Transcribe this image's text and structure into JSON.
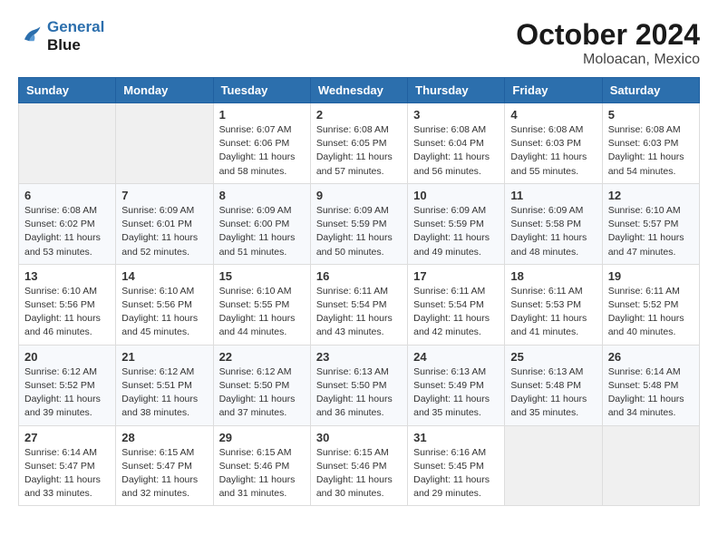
{
  "header": {
    "logo_line1": "General",
    "logo_line2": "Blue",
    "month": "October 2024",
    "location": "Moloacan, Mexico"
  },
  "weekdays": [
    "Sunday",
    "Monday",
    "Tuesday",
    "Wednesday",
    "Thursday",
    "Friday",
    "Saturday"
  ],
  "weeks": [
    [
      {
        "day": "",
        "sunrise": "",
        "sunset": "",
        "daylight": ""
      },
      {
        "day": "",
        "sunrise": "",
        "sunset": "",
        "daylight": ""
      },
      {
        "day": "1",
        "sunrise": "Sunrise: 6:07 AM",
        "sunset": "Sunset: 6:06 PM",
        "daylight": "Daylight: 11 hours and 58 minutes."
      },
      {
        "day": "2",
        "sunrise": "Sunrise: 6:08 AM",
        "sunset": "Sunset: 6:05 PM",
        "daylight": "Daylight: 11 hours and 57 minutes."
      },
      {
        "day": "3",
        "sunrise": "Sunrise: 6:08 AM",
        "sunset": "Sunset: 6:04 PM",
        "daylight": "Daylight: 11 hours and 56 minutes."
      },
      {
        "day": "4",
        "sunrise": "Sunrise: 6:08 AM",
        "sunset": "Sunset: 6:03 PM",
        "daylight": "Daylight: 11 hours and 55 minutes."
      },
      {
        "day": "5",
        "sunrise": "Sunrise: 6:08 AM",
        "sunset": "Sunset: 6:03 PM",
        "daylight": "Daylight: 11 hours and 54 minutes."
      }
    ],
    [
      {
        "day": "6",
        "sunrise": "Sunrise: 6:08 AM",
        "sunset": "Sunset: 6:02 PM",
        "daylight": "Daylight: 11 hours and 53 minutes."
      },
      {
        "day": "7",
        "sunrise": "Sunrise: 6:09 AM",
        "sunset": "Sunset: 6:01 PM",
        "daylight": "Daylight: 11 hours and 52 minutes."
      },
      {
        "day": "8",
        "sunrise": "Sunrise: 6:09 AM",
        "sunset": "Sunset: 6:00 PM",
        "daylight": "Daylight: 11 hours and 51 minutes."
      },
      {
        "day": "9",
        "sunrise": "Sunrise: 6:09 AM",
        "sunset": "Sunset: 5:59 PM",
        "daylight": "Daylight: 11 hours and 50 minutes."
      },
      {
        "day": "10",
        "sunrise": "Sunrise: 6:09 AM",
        "sunset": "Sunset: 5:59 PM",
        "daylight": "Daylight: 11 hours and 49 minutes."
      },
      {
        "day": "11",
        "sunrise": "Sunrise: 6:09 AM",
        "sunset": "Sunset: 5:58 PM",
        "daylight": "Daylight: 11 hours and 48 minutes."
      },
      {
        "day": "12",
        "sunrise": "Sunrise: 6:10 AM",
        "sunset": "Sunset: 5:57 PM",
        "daylight": "Daylight: 11 hours and 47 minutes."
      }
    ],
    [
      {
        "day": "13",
        "sunrise": "Sunrise: 6:10 AM",
        "sunset": "Sunset: 5:56 PM",
        "daylight": "Daylight: 11 hours and 46 minutes."
      },
      {
        "day": "14",
        "sunrise": "Sunrise: 6:10 AM",
        "sunset": "Sunset: 5:56 PM",
        "daylight": "Daylight: 11 hours and 45 minutes."
      },
      {
        "day": "15",
        "sunrise": "Sunrise: 6:10 AM",
        "sunset": "Sunset: 5:55 PM",
        "daylight": "Daylight: 11 hours and 44 minutes."
      },
      {
        "day": "16",
        "sunrise": "Sunrise: 6:11 AM",
        "sunset": "Sunset: 5:54 PM",
        "daylight": "Daylight: 11 hours and 43 minutes."
      },
      {
        "day": "17",
        "sunrise": "Sunrise: 6:11 AM",
        "sunset": "Sunset: 5:54 PM",
        "daylight": "Daylight: 11 hours and 42 minutes."
      },
      {
        "day": "18",
        "sunrise": "Sunrise: 6:11 AM",
        "sunset": "Sunset: 5:53 PM",
        "daylight": "Daylight: 11 hours and 41 minutes."
      },
      {
        "day": "19",
        "sunrise": "Sunrise: 6:11 AM",
        "sunset": "Sunset: 5:52 PM",
        "daylight": "Daylight: 11 hours and 40 minutes."
      }
    ],
    [
      {
        "day": "20",
        "sunrise": "Sunrise: 6:12 AM",
        "sunset": "Sunset: 5:52 PM",
        "daylight": "Daylight: 11 hours and 39 minutes."
      },
      {
        "day": "21",
        "sunrise": "Sunrise: 6:12 AM",
        "sunset": "Sunset: 5:51 PM",
        "daylight": "Daylight: 11 hours and 38 minutes."
      },
      {
        "day": "22",
        "sunrise": "Sunrise: 6:12 AM",
        "sunset": "Sunset: 5:50 PM",
        "daylight": "Daylight: 11 hours and 37 minutes."
      },
      {
        "day": "23",
        "sunrise": "Sunrise: 6:13 AM",
        "sunset": "Sunset: 5:50 PM",
        "daylight": "Daylight: 11 hours and 36 minutes."
      },
      {
        "day": "24",
        "sunrise": "Sunrise: 6:13 AM",
        "sunset": "Sunset: 5:49 PM",
        "daylight": "Daylight: 11 hours and 35 minutes."
      },
      {
        "day": "25",
        "sunrise": "Sunrise: 6:13 AM",
        "sunset": "Sunset: 5:48 PM",
        "daylight": "Daylight: 11 hours and 35 minutes."
      },
      {
        "day": "26",
        "sunrise": "Sunrise: 6:14 AM",
        "sunset": "Sunset: 5:48 PM",
        "daylight": "Daylight: 11 hours and 34 minutes."
      }
    ],
    [
      {
        "day": "27",
        "sunrise": "Sunrise: 6:14 AM",
        "sunset": "Sunset: 5:47 PM",
        "daylight": "Daylight: 11 hours and 33 minutes."
      },
      {
        "day": "28",
        "sunrise": "Sunrise: 6:15 AM",
        "sunset": "Sunset: 5:47 PM",
        "daylight": "Daylight: 11 hours and 32 minutes."
      },
      {
        "day": "29",
        "sunrise": "Sunrise: 6:15 AM",
        "sunset": "Sunset: 5:46 PM",
        "daylight": "Daylight: 11 hours and 31 minutes."
      },
      {
        "day": "30",
        "sunrise": "Sunrise: 6:15 AM",
        "sunset": "Sunset: 5:46 PM",
        "daylight": "Daylight: 11 hours and 30 minutes."
      },
      {
        "day": "31",
        "sunrise": "Sunrise: 6:16 AM",
        "sunset": "Sunset: 5:45 PM",
        "daylight": "Daylight: 11 hours and 29 minutes."
      },
      {
        "day": "",
        "sunrise": "",
        "sunset": "",
        "daylight": ""
      },
      {
        "day": "",
        "sunrise": "",
        "sunset": "",
        "daylight": ""
      }
    ]
  ]
}
